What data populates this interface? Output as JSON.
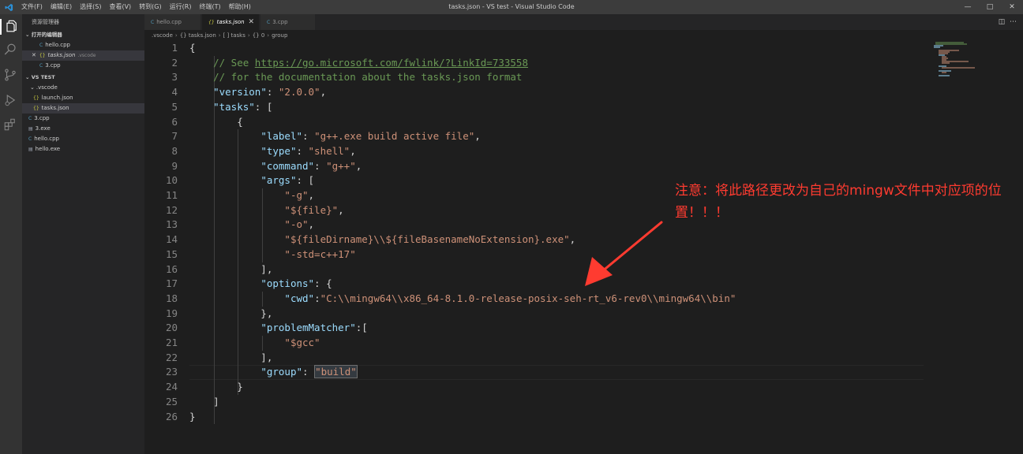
{
  "titlebar": {
    "title": "tasks.json - VS test - Visual Studio Code",
    "menu": [
      "文件(F)",
      "编辑(E)",
      "选择(S)",
      "查看(V)",
      "转到(G)",
      "运行(R)",
      "终端(T)",
      "帮助(H)"
    ]
  },
  "sidebar": {
    "title": "资源管理器",
    "open_editors_label": "打开的编辑器",
    "open_editors": [
      {
        "name": "hello.cpp",
        "icon": "cpp-file-icon",
        "dir": ""
      },
      {
        "name": "tasks.json",
        "icon": "json-file-icon",
        "dir": ".vscode"
      },
      {
        "name": "3.cpp",
        "icon": "cpp-file-icon",
        "dir": ""
      }
    ],
    "folder_label": "VS TEST",
    "tree": [
      {
        "name": ".vscode",
        "type": "folder"
      },
      {
        "name": "launch.json",
        "type": "json"
      },
      {
        "name": "tasks.json",
        "type": "json"
      },
      {
        "name": "3.cpp",
        "type": "cpp"
      },
      {
        "name": "3.exe",
        "type": "exe"
      },
      {
        "name": "hello.cpp",
        "type": "cpp"
      },
      {
        "name": "hello.exe",
        "type": "exe"
      }
    ]
  },
  "tabs": [
    {
      "label": "hello.cpp",
      "icon": "cpp-file-icon",
      "active": false
    },
    {
      "label": "tasks.json",
      "icon": "json-file-icon",
      "active": true
    },
    {
      "label": "3.cpp",
      "icon": "cpp-file-icon",
      "active": false
    }
  ],
  "breadcrumb": [
    ".vscode",
    "{} tasks.json",
    "[ ] tasks",
    "{} 0",
    "group"
  ],
  "editor": {
    "line_numbers": [
      "1",
      "2",
      "3",
      "4",
      "5",
      "6",
      "7",
      "8",
      "9",
      "10",
      "11",
      "12",
      "13",
      "14",
      "15",
      "16",
      "17",
      "18",
      "19",
      "20",
      "21",
      "22",
      "23",
      "24",
      "25",
      "26"
    ],
    "lines": [
      [
        [
          "p",
          "{"
        ]
      ],
      [
        [
          "p",
          "    "
        ],
        [
          "c",
          "// See "
        ],
        [
          "u",
          "https://go.microsoft.com/fwlink/?LinkId=733558"
        ]
      ],
      [
        [
          "p",
          "    "
        ],
        [
          "c",
          "// for the documentation about the tasks.json format"
        ]
      ],
      [
        [
          "p",
          "    "
        ],
        [
          "k",
          "\"version\""
        ],
        [
          "p",
          ": "
        ],
        [
          "s",
          "\"2.0.0\""
        ],
        [
          "p",
          ","
        ]
      ],
      [
        [
          "p",
          "    "
        ],
        [
          "k",
          "\"tasks\""
        ],
        [
          "p",
          ": ["
        ]
      ],
      [
        [
          "p",
          "        {"
        ]
      ],
      [
        [
          "p",
          "            "
        ],
        [
          "k",
          "\"label\""
        ],
        [
          "p",
          ": "
        ],
        [
          "s",
          "\"g++.exe build active file\""
        ],
        [
          "p",
          ","
        ]
      ],
      [
        [
          "p",
          "            "
        ],
        [
          "k",
          "\"type\""
        ],
        [
          "p",
          ": "
        ],
        [
          "s",
          "\"shell\""
        ],
        [
          "p",
          ","
        ]
      ],
      [
        [
          "p",
          "            "
        ],
        [
          "k",
          "\"command\""
        ],
        [
          "p",
          ": "
        ],
        [
          "s",
          "\"g++\""
        ],
        [
          "p",
          ","
        ]
      ],
      [
        [
          "p",
          "            "
        ],
        [
          "k",
          "\"args\""
        ],
        [
          "p",
          ": ["
        ]
      ],
      [
        [
          "p",
          "                "
        ],
        [
          "s",
          "\"-g\""
        ],
        [
          "p",
          ","
        ]
      ],
      [
        [
          "p",
          "                "
        ],
        [
          "s",
          "\"${file}\""
        ],
        [
          "p",
          ","
        ]
      ],
      [
        [
          "p",
          "                "
        ],
        [
          "s",
          "\"-o\""
        ],
        [
          "p",
          ","
        ]
      ],
      [
        [
          "p",
          "                "
        ],
        [
          "s",
          "\"${fileDirname}\\\\${fileBasenameNoExtension}.exe\""
        ],
        [
          "p",
          ","
        ]
      ],
      [
        [
          "p",
          "                "
        ],
        [
          "s",
          "\"-std=c++17\""
        ]
      ],
      [
        [
          "p",
          "            ],"
        ]
      ],
      [
        [
          "p",
          "            "
        ],
        [
          "k",
          "\"options\""
        ],
        [
          "p",
          ": {"
        ]
      ],
      [
        [
          "p",
          "                "
        ],
        [
          "k",
          "\"cwd\""
        ],
        [
          "p",
          ":"
        ],
        [
          "s",
          "\"C:\\\\mingw64\\\\x86_64-8.1.0-release-posix-seh-rt_v6-rev0\\\\mingw64\\\\bin\""
        ]
      ],
      [
        [
          "p",
          "            },"
        ]
      ],
      [
        [
          "p",
          "            "
        ],
        [
          "k",
          "\"problemMatcher\""
        ],
        [
          "p",
          ":["
        ]
      ],
      [
        [
          "p",
          "                "
        ],
        [
          "s",
          "\"$gcc\""
        ]
      ],
      [
        [
          "p",
          "            ],"
        ]
      ],
      [
        [
          "p",
          "            "
        ],
        [
          "k",
          "\"group\""
        ],
        [
          "p",
          ": "
        ],
        [
          "h",
          "\"build\""
        ]
      ],
      [
        [
          "p",
          "        }"
        ]
      ],
      [
        [
          "p",
          "    ]"
        ]
      ],
      [
        [
          "p",
          "}"
        ]
      ]
    ]
  },
  "annotation": {
    "text": "注意：将此路径更改为自己的mingw文件中对应项的位置！！！",
    "color": "#ff3b30"
  },
  "colors": {
    "key": "#9cdcfe",
    "string": "#ce9178",
    "comment": "#6a9955",
    "punct": "#d4d4d4"
  }
}
